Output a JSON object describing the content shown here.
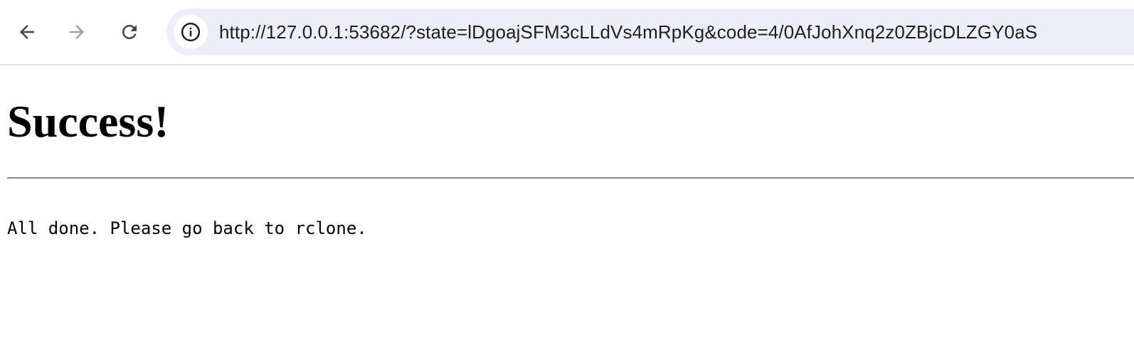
{
  "browser": {
    "back_icon": "arrow-left-icon",
    "forward_icon": "arrow-right-icon",
    "reload_icon": "reload-icon",
    "site_info_icon": "info-circle-icon",
    "url": "http://127.0.0.1:53682/?state=lDgoajSFM3cLLdVs4mRpKg&code=4/0AfJohXnq2z0ZBjcDLZGY0aS",
    "forward_enabled": false
  },
  "page": {
    "title": "Success!",
    "message": "All done. Please go back to rclone."
  },
  "colors": {
    "omnibox_bg": "#edeff7",
    "icon_active": "#444746",
    "icon_disabled": "#a0a0a0"
  }
}
